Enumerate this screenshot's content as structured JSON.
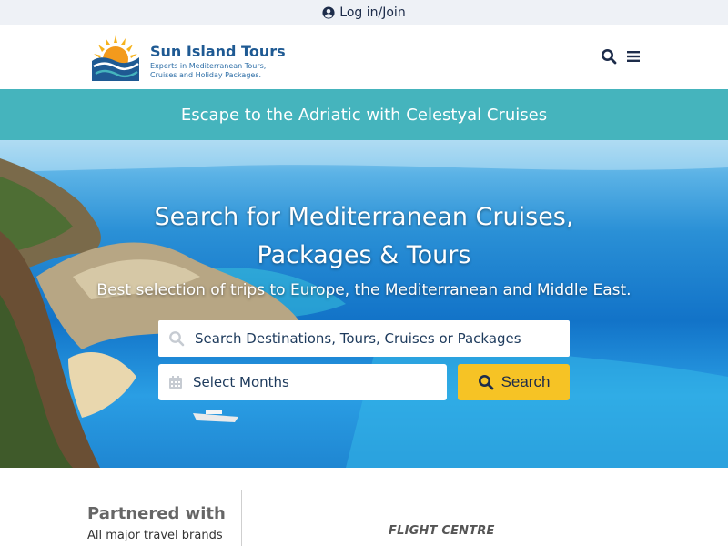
{
  "topbar": {
    "login_label": "Log in/Join",
    "icon": "user-circle-icon"
  },
  "header": {
    "brand": "Sun Island Tours",
    "tagline_line1": "Experts in Mediterranean Tours,",
    "tagline_line2": "Cruises and Holiday Packages.",
    "icons": [
      "search-icon",
      "hamburger-menu-icon"
    ]
  },
  "promo": {
    "text": "Escape to the Adriatic with Celestyal Cruises"
  },
  "hero": {
    "title_line1": "Search for Mediterranean Cruises,",
    "title_line2": "Packages & Tours",
    "subtitle": "Best selection of trips to Europe, the Mediterranean and Middle East.",
    "search_placeholder": "Search Destinations, Tours, Cruises or Packages",
    "months_label": "Select Months",
    "search_button": "Search"
  },
  "partners": {
    "title": "Partnered with",
    "subtitle": "All major travel brands",
    "logos": [
      "FLIGHT CENTRE"
    ]
  },
  "colors": {
    "topbar_bg": "#eef1f6",
    "brand_blue": "#1f5a93",
    "promo_teal": "#45b4bd",
    "search_yellow": "#f6c325",
    "navy_text": "#1d2c4a"
  }
}
